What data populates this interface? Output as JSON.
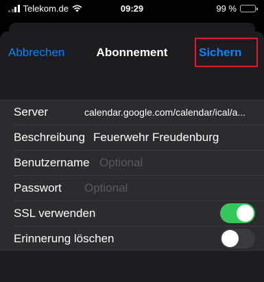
{
  "status_bar": {
    "carrier": "Telekom.de",
    "time": "09:29",
    "battery": "99 %",
    "battery_level_percent": 99,
    "wifi_icon": "wifi-icon",
    "signal_icon": "cellular-signal-icon"
  },
  "nav": {
    "cancel_label": "Abbrechen",
    "title": "Abonnement",
    "save_label": "Sichern"
  },
  "form": {
    "server_label": "Server",
    "server_value": "calendar.google.com/calendar/ical/a...",
    "description_label": "Beschreibung",
    "description_value": "Feuerwehr Freudenburg",
    "username_label": "Benutzername",
    "username_placeholder": "Optional",
    "password_label": "Passwort",
    "password_placeholder": "Optional",
    "ssl_label": "SSL verwenden",
    "ssl_enabled": true,
    "remove_alarms_label": "Erinnerung löschen",
    "remove_alarms_enabled": false
  },
  "colors": {
    "accent": "#0a84ff",
    "switch_on": "#34c759",
    "highlight": "#e0192e",
    "background": "#1c1c1e",
    "cell": "#2c2c2e"
  }
}
